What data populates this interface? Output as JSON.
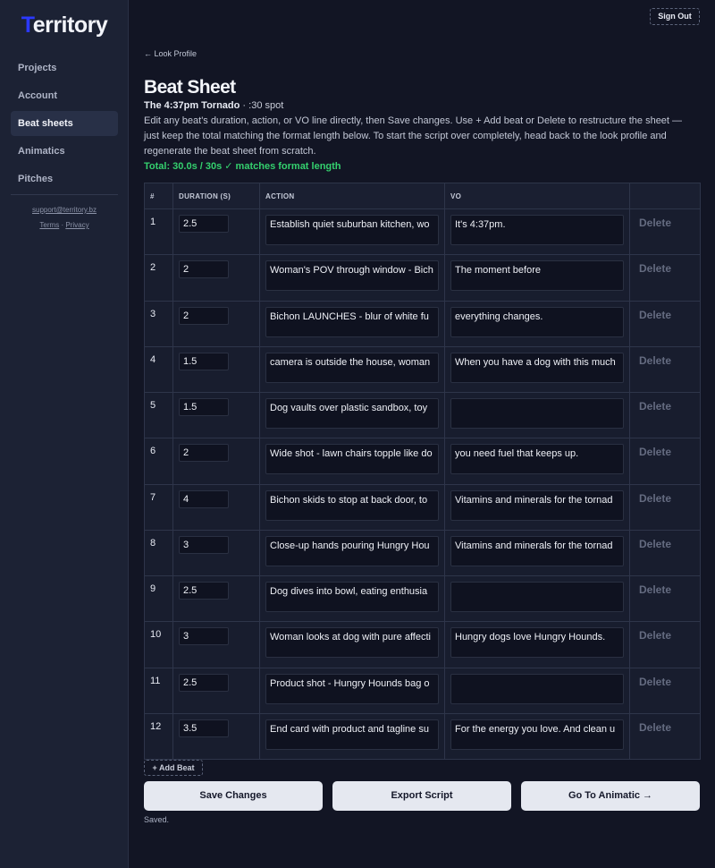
{
  "app": {
    "logo_first": "T",
    "logo_rest": "erritory",
    "sign_out": "Sign Out"
  },
  "sidebar": {
    "items": [
      {
        "label": "Projects",
        "active": false
      },
      {
        "label": "Account",
        "active": false
      },
      {
        "label": "Beat sheets",
        "active": true
      },
      {
        "label": "Animatics",
        "active": false
      },
      {
        "label": "Pitches",
        "active": false
      }
    ],
    "support_email": "support@territory.bz",
    "terms": "Terms",
    "separator": "·",
    "privacy": "Privacy"
  },
  "main": {
    "back_link": "← Look Profile",
    "title": "Beat Sheet",
    "subtitle_name": "The 4:37pm Tornado",
    "subtitle_rest": " · :30 spot",
    "description": "Edit any beat's duration, action, or VO line directly, then Save changes. Use + Add beat or Delete to restructure the sheet — just keep the total matching the format length below. To start the script over completely, head back to the look profile and regenerate the beat sheet from scratch.",
    "total": "Total: 30.0s / 30s ✓ matches format length"
  },
  "table": {
    "headers": [
      "#",
      "DURATION (S)",
      "ACTION",
      "VO",
      ""
    ],
    "delete_label": "Delete",
    "rows": [
      {
        "num": "1",
        "duration": "2.5",
        "action": "Establish quiet suburban kitchen, wo",
        "vo": "It's 4:37pm."
      },
      {
        "num": "2",
        "duration": "2",
        "action": "Woman's POV through window - Bich",
        "vo": "The moment before"
      },
      {
        "num": "3",
        "duration": "2",
        "action": "Bichon LAUNCHES - blur of white fu",
        "vo": "everything changes."
      },
      {
        "num": "4",
        "duration": "1.5",
        "action": "camera is outside the house, woman",
        "vo": "When you have a dog with this much"
      },
      {
        "num": "5",
        "duration": "1.5",
        "action": "Dog vaults over plastic sandbox, toy",
        "vo": ""
      },
      {
        "num": "6",
        "duration": "2",
        "action": "Wide shot - lawn chairs topple like do",
        "vo": "you need fuel that keeps up."
      },
      {
        "num": "7",
        "duration": "4",
        "action": "Bichon skids to stop at back door, to",
        "vo": "Vitamins and minerals for the tornad"
      },
      {
        "num": "8",
        "duration": "3",
        "action": "Close-up hands pouring Hungry Hou",
        "vo": "Vitamins and minerals for the tornad"
      },
      {
        "num": "9",
        "duration": "2.5",
        "action": "Dog dives into bowl, eating enthusia",
        "vo": ""
      },
      {
        "num": "10",
        "duration": "3",
        "action": "Woman looks at dog with pure affecti",
        "vo": "Hungry dogs love Hungry Hounds."
      },
      {
        "num": "11",
        "duration": "2.5",
        "action": "Product shot - Hungry Hounds bag o",
        "vo": ""
      },
      {
        "num": "12",
        "duration": "3.5",
        "action": "End card with product and tagline su",
        "vo": "For the energy you love. And clean u"
      }
    ]
  },
  "actions": {
    "add_beat": "+ Add Beat",
    "save": "Save Changes",
    "export": "Export Script",
    "animatic": "Go To Animatic →",
    "status": "Saved."
  }
}
